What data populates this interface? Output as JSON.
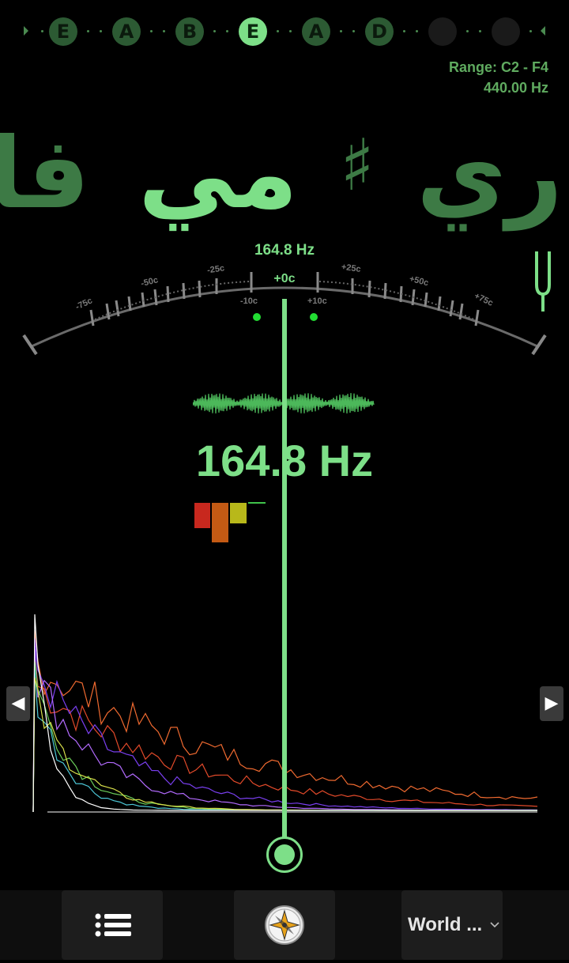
{
  "strings": {
    "notes": [
      "E",
      "A",
      "B",
      "E",
      "A",
      "D",
      "",
      ""
    ],
    "active_index": 3
  },
  "range": {
    "range_label": "Range: C2 - F4",
    "reference": "440.00 Hz"
  },
  "note_display": {
    "left_note": "فا",
    "center_note": "مي",
    "sharp": "♯",
    "right_note": "ري"
  },
  "meter": {
    "frequency_label": "164.8 Hz",
    "cents_label": "+0c",
    "ticks": [
      "-75c",
      "-50c",
      "-25c",
      "-10c",
      "+10c",
      "+25c",
      "+50c",
      "+75c"
    ],
    "cents_offset": 0
  },
  "reading": {
    "frequency": "164.8 Hz"
  },
  "spectrum": {
    "colors": [
      "#e34a2a",
      "#f06a30",
      "#7a3ff0",
      "#b36bff",
      "#6ccf5a",
      "#4cc6d6",
      "#d8e04a",
      "#ffffff"
    ]
  },
  "nav": {
    "prev_icon": "left-arrow-icon",
    "next_icon": "right-arrow-icon",
    "prev_glyph": "◀",
    "next_glyph": "▶"
  },
  "bottom_bar": {
    "menu_icon": "list-icon",
    "compass_icon": "compass-icon",
    "tuning_label": "World ...",
    "dropdown_icon": "chevron-down-icon"
  }
}
